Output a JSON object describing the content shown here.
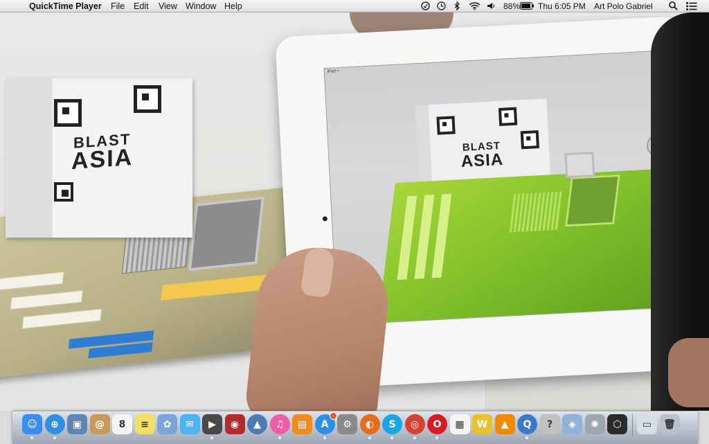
{
  "menubar": {
    "apple_glyph": "",
    "app_name": "QuickTime Player",
    "menus": [
      "File",
      "Edit",
      "View",
      "Window",
      "Help"
    ],
    "status": {
      "battery": "88%",
      "clock": "Thu 6:05 PM",
      "user": "Art Polo Gabriel"
    }
  },
  "scene": {
    "box_text_line1": "BLAST",
    "box_text_line2": "ASIA",
    "ipad_text_line1": "BLAST",
    "ipad_text_line2": "ASIA",
    "ipad_status": "iPad ≈"
  },
  "dock": {
    "icons": [
      {
        "name": "finder-icon",
        "glyph": "☺",
        "color": "#3a8ee6"
      },
      {
        "name": "safari-icon",
        "glyph": "⊕",
        "color": "#2f8fe0"
      },
      {
        "name": "preview-icon",
        "glyph": "▣",
        "color": "#5b86b5"
      },
      {
        "name": "contacts-icon",
        "glyph": "@",
        "color": "#c69a5c"
      },
      {
        "name": "calendar-icon",
        "glyph": "8",
        "color": "#f4f4f4"
      },
      {
        "name": "notes-icon",
        "glyph": "≡",
        "color": "#f2df63"
      },
      {
        "name": "photo-icon",
        "glyph": "✿",
        "color": "#7aa6d9"
      },
      {
        "name": "messages-icon",
        "glyph": "✉",
        "color": "#4fb3f2"
      },
      {
        "name": "facetime-icon",
        "glyph": "▶",
        "color": "#4a4a4a"
      },
      {
        "name": "photobooth-icon",
        "glyph": "◉",
        "color": "#b52a2a"
      },
      {
        "name": "iphoto-icon",
        "glyph": "▲",
        "color": "#4b7db0"
      },
      {
        "name": "itunes-icon",
        "glyph": "♫",
        "color": "#ef5da8"
      },
      {
        "name": "ibooks-icon",
        "glyph": "▤",
        "color": "#f08b1e"
      },
      {
        "name": "appstore-icon",
        "glyph": "A",
        "color": "#2c8fe6"
      },
      {
        "name": "system-preferences-icon",
        "glyph": "⚙",
        "color": "#8a8a8a"
      },
      {
        "name": "firefox-icon",
        "glyph": "◐",
        "color": "#e66b1d"
      },
      {
        "name": "skype-icon",
        "glyph": "S",
        "color": "#19a5e6"
      },
      {
        "name": "chrome-icon",
        "glyph": "◎",
        "color": "#d64133"
      },
      {
        "name": "opera-icon",
        "glyph": "O",
        "color": "#d61b24"
      },
      {
        "name": "launchpad-grid-icon",
        "glyph": "▦",
        "color": "#f4f4f4"
      },
      {
        "name": "wireless-icon",
        "glyph": "W",
        "color": "#e8c22a"
      },
      {
        "name": "vlc-icon",
        "glyph": "▲",
        "color": "#f08a00"
      },
      {
        "name": "quicktime-icon",
        "glyph": "Q",
        "color": "#3d79c8"
      },
      {
        "name": "help-icon",
        "glyph": "?",
        "color": "#c0c0c0"
      },
      {
        "name": "preview-app-icon",
        "glyph": "◈",
        "color": "#8fb3d8"
      },
      {
        "name": "utility-icon",
        "glyph": "✺",
        "color": "#9ea7b0"
      },
      {
        "name": "unity-icon",
        "glyph": "⬡",
        "color": "#2b2b2b"
      },
      {
        "name": "documents-folder-icon",
        "glyph": "▭",
        "color": "#d7dde4"
      },
      {
        "name": "trash-icon",
        "glyph": "🗑",
        "color": "#b9c1ca"
      }
    ]
  }
}
